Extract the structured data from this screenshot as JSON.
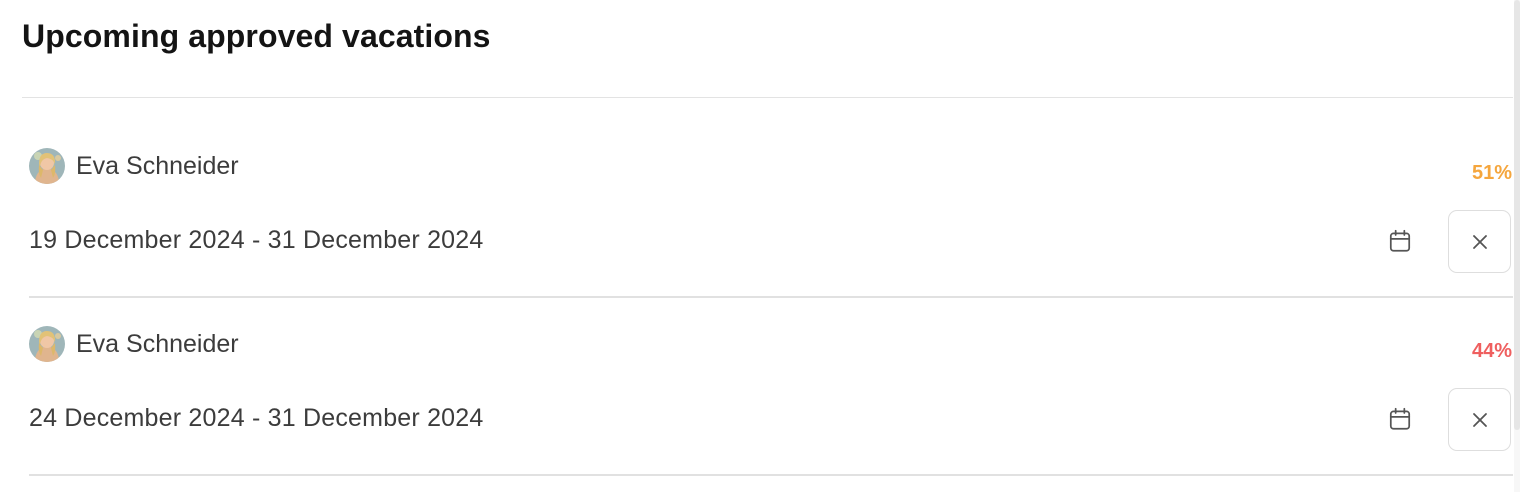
{
  "section": {
    "title": "Upcoming approved vacations"
  },
  "colors": {
    "percent_warning": "#f5a63d",
    "percent_danger": "#ef5f5f"
  },
  "vacations": [
    {
      "person_name": "Eva Schneider",
      "avatar_icon": "avatar-photo",
      "percent": "51%",
      "percent_color": "#f5a63d",
      "date_range": "19 December 2024 - 31 December 2024",
      "calendar_icon": "calendar-icon",
      "close_icon": "close-icon"
    },
    {
      "person_name": "Eva Schneider",
      "avatar_icon": "avatar-photo",
      "percent": "44%",
      "percent_color": "#ef5f5f",
      "date_range": "24 December 2024 - 31 December 2024",
      "calendar_icon": "calendar-icon",
      "close_icon": "close-icon"
    }
  ]
}
